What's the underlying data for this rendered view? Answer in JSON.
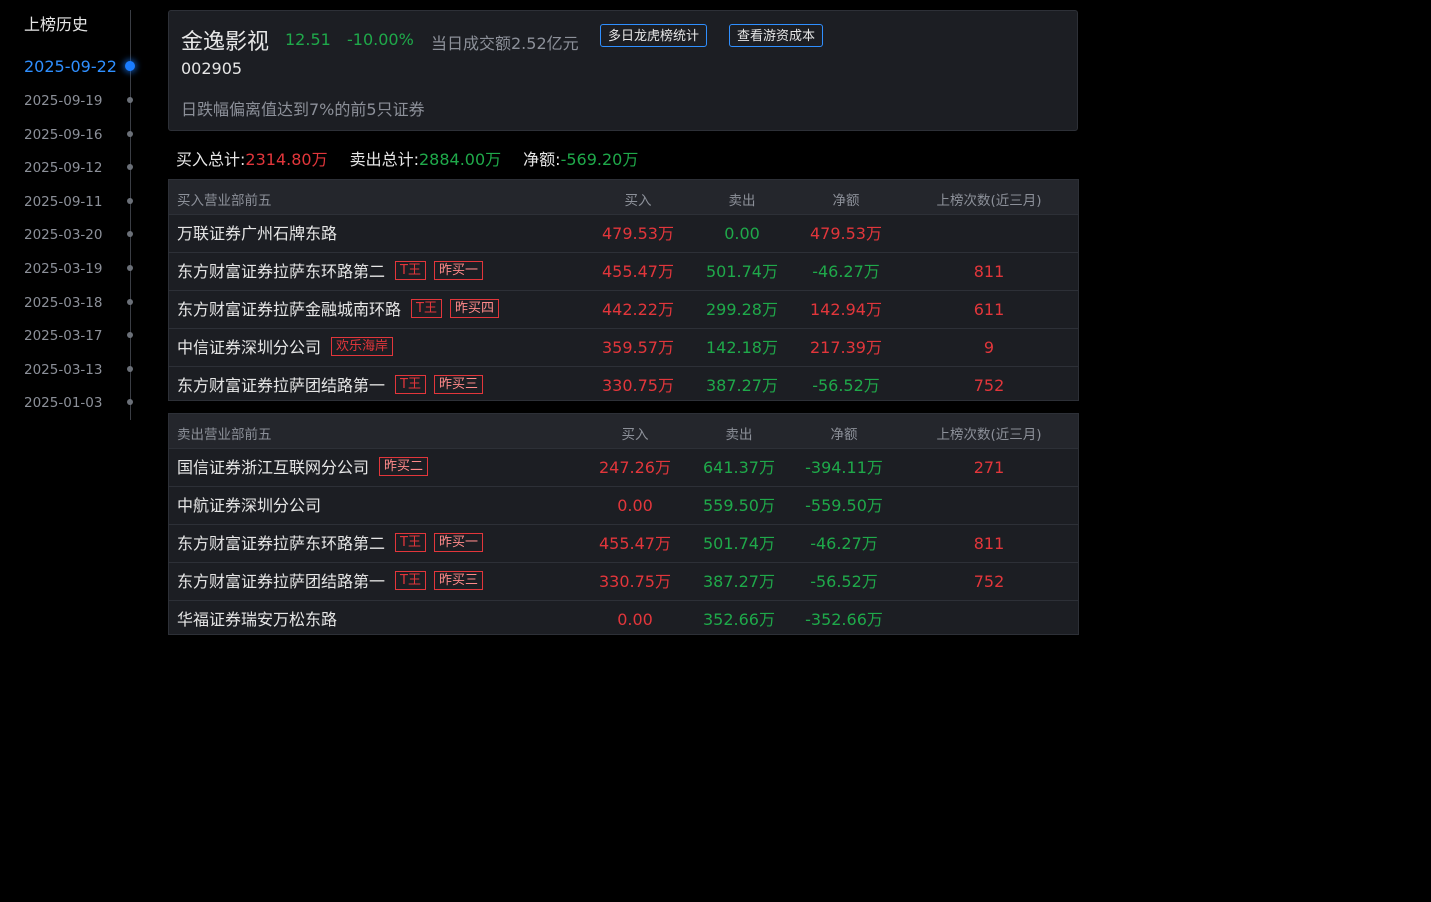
{
  "sidebar": {
    "title": "上榜历史",
    "dates": [
      "2025-09-22",
      "2025-09-19",
      "2025-09-16",
      "2025-09-12",
      "2025-09-11",
      "2025-03-20",
      "2025-03-19",
      "2025-03-18",
      "2025-03-17",
      "2025-03-13",
      "2025-01-03"
    ],
    "active_index": 0
  },
  "header": {
    "name": "金逸影视",
    "price": "12.51",
    "change": "-10.00%",
    "volume": "当日成交额2.52亿元",
    "code": "002905",
    "reason": "日跌幅偏离值达到7%的前5只证券",
    "btn_multi": "多日龙虎榜统计",
    "btn_cost": "查看游资成本"
  },
  "totals": {
    "buy_label": "买入总计:",
    "buy_value": "2314.80万",
    "sell_label": "卖出总计:",
    "sell_value": "2884.00万",
    "net_label": "净额:",
    "net_value": "-569.20万"
  },
  "buy_table": {
    "headers": [
      "买入营业部前五",
      "买入",
      "卖出",
      "净额",
      "上榜次数(近三月)"
    ],
    "rows": [
      {
        "name": "万联证券广州石牌东路",
        "tags": [],
        "buy": "479.53万",
        "sell": "0.00",
        "net": "479.53万",
        "count": ""
      },
      {
        "name": "东方财富证券拉萨东环路第二",
        "tags": [
          "T王",
          "昨买一"
        ],
        "buy": "455.47万",
        "sell": "501.74万",
        "net": "-46.27万",
        "count": "811"
      },
      {
        "name": "东方财富证券拉萨金融城南环路",
        "tags": [
          "T王",
          "昨买四"
        ],
        "buy": "442.22万",
        "sell": "299.28万",
        "net": "142.94万",
        "count": "611"
      },
      {
        "name": "中信证券深圳分公司",
        "tags": [
          "欢乐海岸"
        ],
        "buy": "359.57万",
        "sell": "142.18万",
        "net": "217.39万",
        "count": "9"
      },
      {
        "name": "东方财富证券拉萨团结路第一",
        "tags": [
          "T王",
          "昨买三"
        ],
        "buy": "330.75万",
        "sell": "387.27万",
        "net": "-56.52万",
        "count": "752"
      }
    ]
  },
  "sell_table": {
    "headers": [
      "卖出营业部前五",
      "买入",
      "卖出",
      "净额",
      "上榜次数(近三月)"
    ],
    "rows": [
      {
        "name": "国信证券浙江互联网分公司",
        "tags": [
          "昨买二"
        ],
        "buy": "247.26万",
        "sell": "641.37万",
        "net": "-394.11万",
        "count": "271"
      },
      {
        "name": "中航证券深圳分公司",
        "tags": [],
        "buy": "0.00",
        "sell": "559.50万",
        "net": "-559.50万",
        "count": ""
      },
      {
        "name": "东方财富证券拉萨东环路第二",
        "tags": [
          "T王",
          "昨买一"
        ],
        "buy": "455.47万",
        "sell": "501.74万",
        "net": "-46.27万",
        "count": "811"
      },
      {
        "name": "东方财富证券拉萨团结路第一",
        "tags": [
          "T王",
          "昨买三"
        ],
        "buy": "330.75万",
        "sell": "387.27万",
        "net": "-56.52万",
        "count": "752"
      },
      {
        "name": "华福证券瑞安万松东路",
        "tags": [],
        "buy": "0.00",
        "sell": "352.66万",
        "net": "-352.66万",
        "count": ""
      }
    ]
  },
  "colors": {
    "up": "#e2363b",
    "down": "#1fa94a",
    "accent": "#2f8fff"
  }
}
